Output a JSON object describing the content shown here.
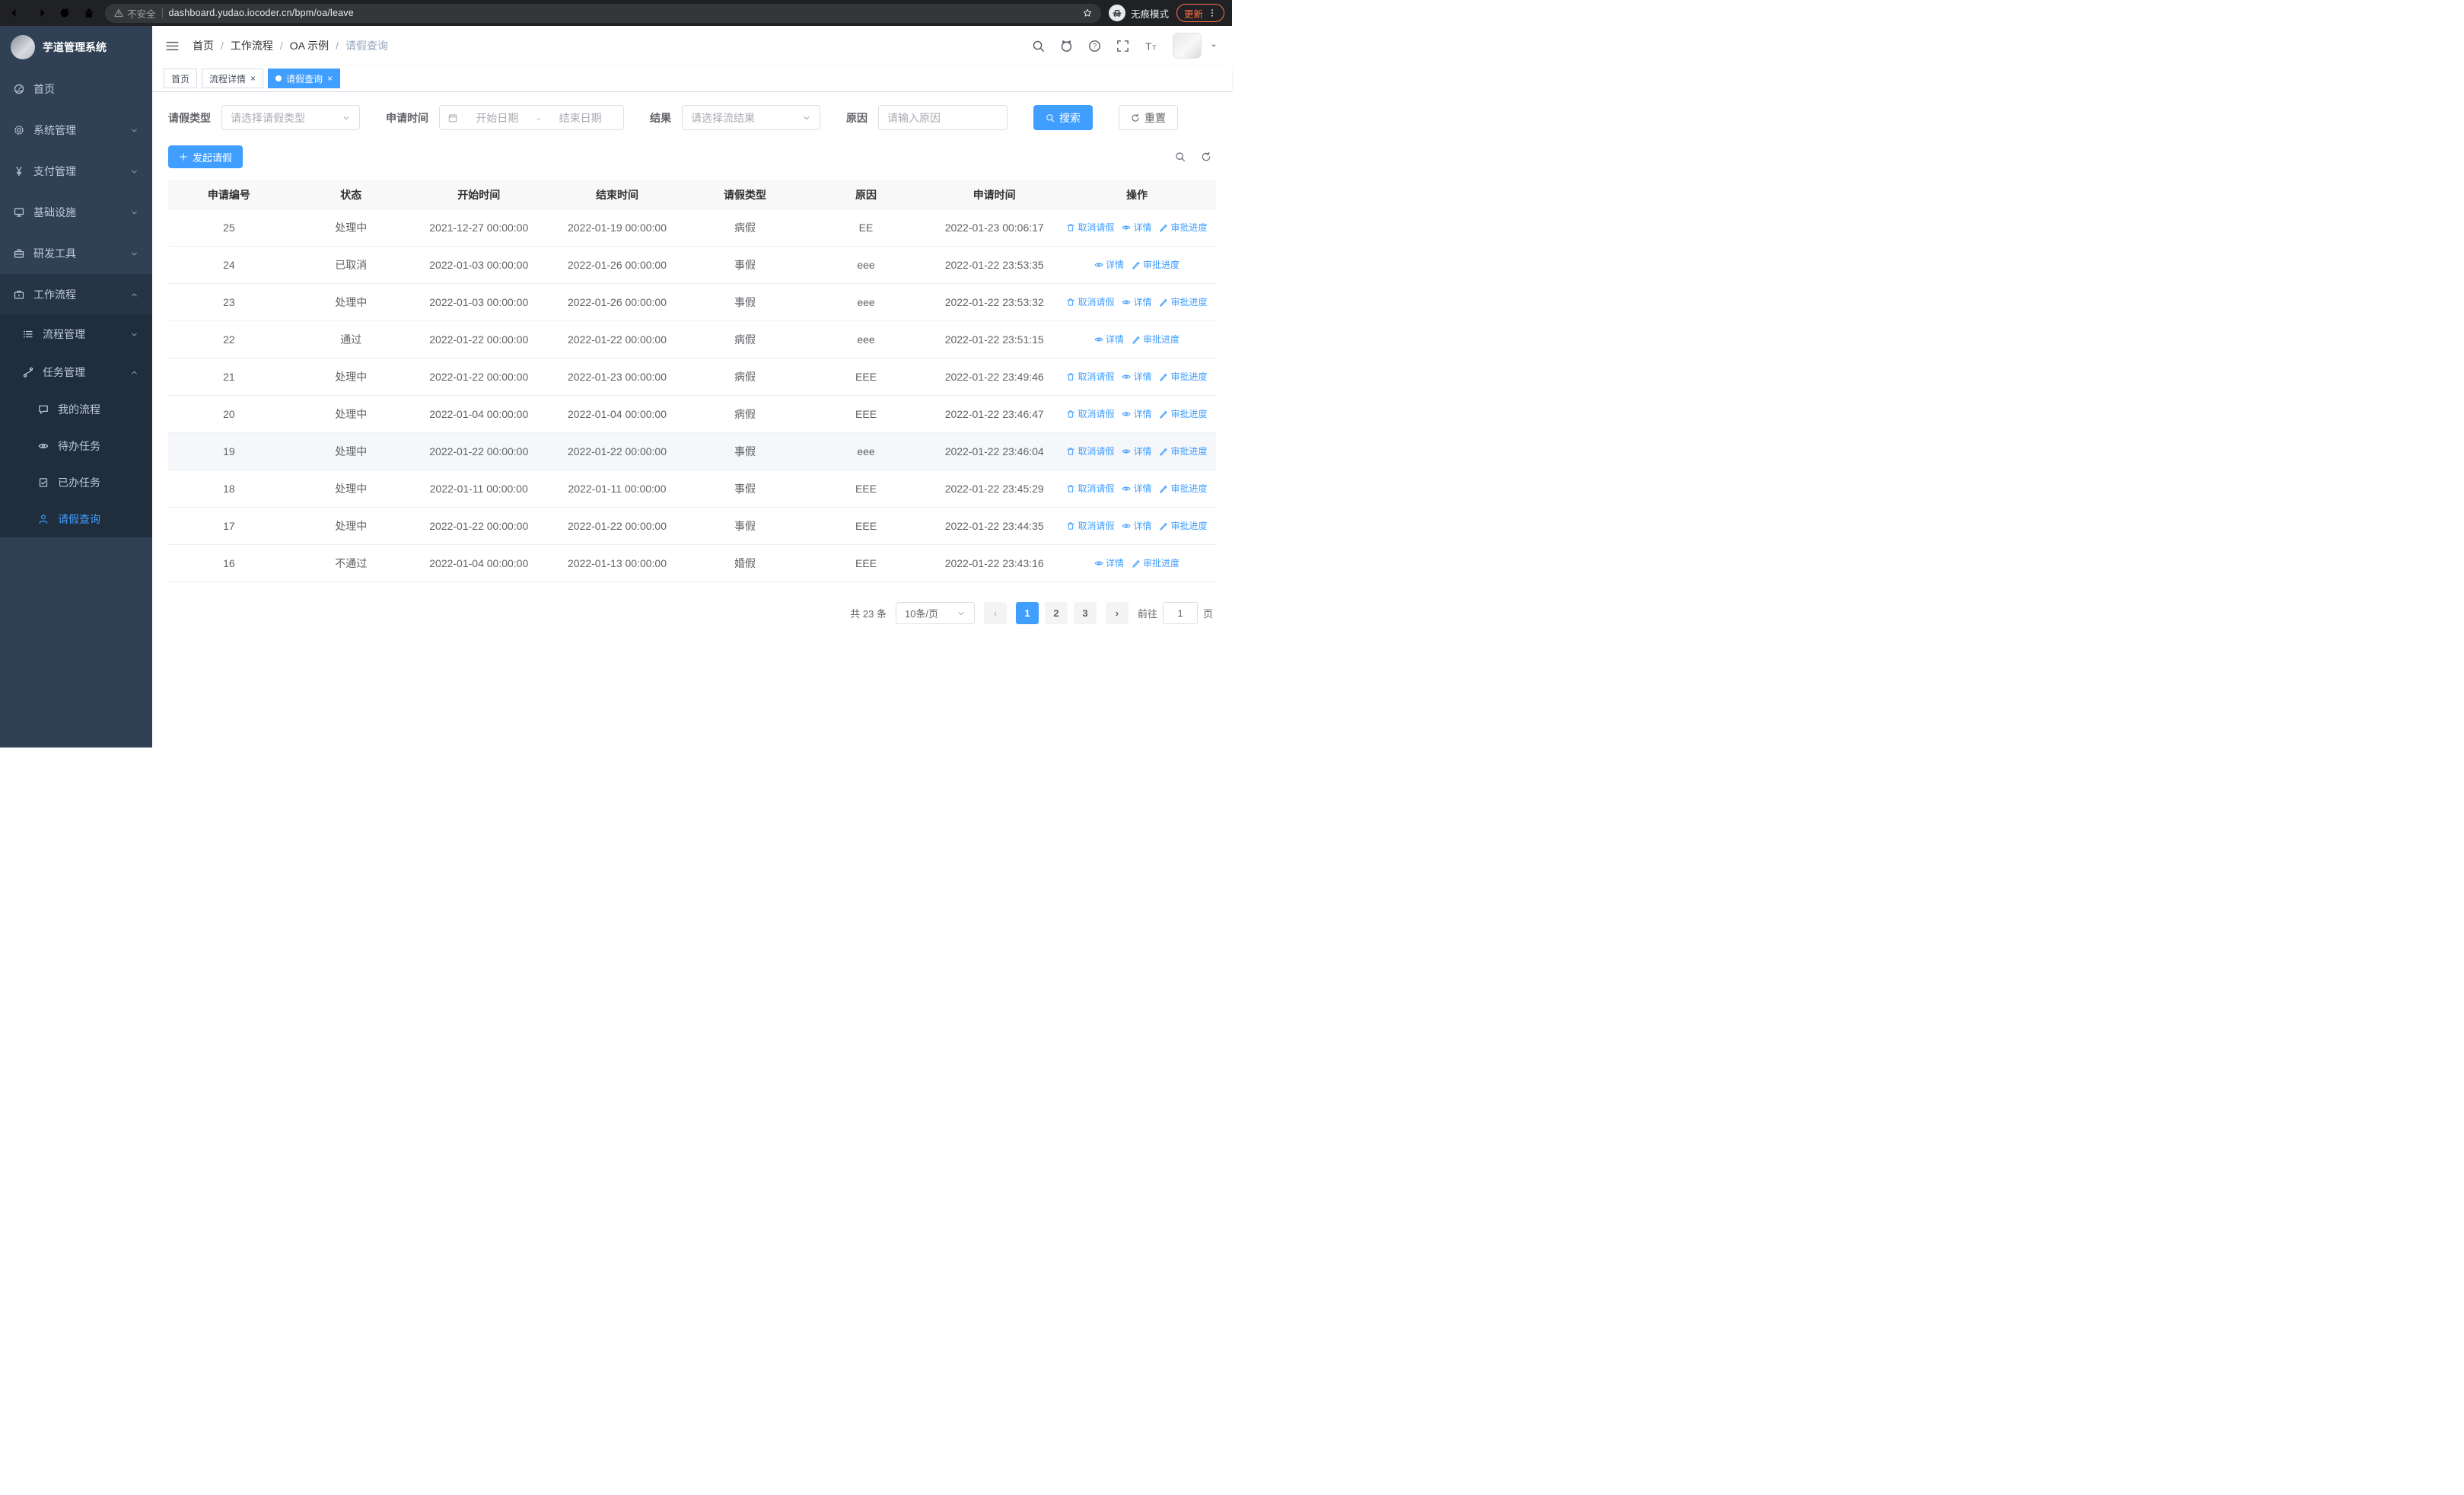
{
  "browser": {
    "security_label": "不安全",
    "url": "dashboard.yudao.iocoder.cn/bpm/oa/leave",
    "incognito_label": "无痕模式",
    "update_label": "更新"
  },
  "app_title": "芋道管理系统",
  "sidebar": {
    "items": [
      {
        "label": "首页",
        "icon": "dashboard-icon",
        "level": 1
      },
      {
        "label": "系统管理",
        "icon": "gear-icon",
        "level": 1,
        "chevron": "down"
      },
      {
        "label": "支付管理",
        "icon": "yen-icon",
        "level": 1,
        "chevron": "down"
      },
      {
        "label": "基础设施",
        "icon": "monitor-icon",
        "level": 1,
        "chevron": "down"
      },
      {
        "label": "研发工具",
        "icon": "toolbox-icon",
        "level": 1,
        "chevron": "down"
      },
      {
        "label": "工作流程",
        "icon": "briefcase-icon",
        "level": 1,
        "chevron": "up",
        "open": true
      },
      {
        "label": "流程管理",
        "icon": "list-icon",
        "level": 2,
        "chevron": "down"
      },
      {
        "label": "任务管理",
        "icon": "flow-icon",
        "level": 2,
        "chevron": "up",
        "open": true
      },
      {
        "label": "我的流程",
        "icon": "chat-icon",
        "level": 3
      },
      {
        "label": "待办任务",
        "icon": "eye-icon",
        "level": 3
      },
      {
        "label": "已办任务",
        "icon": "done-icon",
        "level": 3
      },
      {
        "label": "请假查询",
        "icon": "user-icon",
        "level": 3,
        "active": true
      }
    ]
  },
  "breadcrumb": [
    "首页",
    "工作流程",
    "OA 示例",
    "请假查询"
  ],
  "breadcrumb_separator": "/",
  "tabs": [
    {
      "label": "首页",
      "closable": false,
      "active": false
    },
    {
      "label": "流程详情",
      "closable": true,
      "active": false
    },
    {
      "label": "请假查询",
      "closable": true,
      "active": true
    }
  ],
  "ui": {
    "close_glyph": "×"
  },
  "filters": {
    "leave_type_label": "请假类型",
    "leave_type_placeholder": "请选择请假类型",
    "apply_time_label": "申请时间",
    "start_date_placeholder": "开始日期",
    "range_separator": "-",
    "end_date_placeholder": "结束日期",
    "result_label": "结果",
    "result_placeholder": "请选择流结果",
    "reason_label": "原因",
    "reason_placeholder": "请输入原因",
    "search_button": "搜索",
    "reset_button": "重置"
  },
  "toolbar": {
    "create_button": "发起请假"
  },
  "table": {
    "columns": [
      "申请编号",
      "状态",
      "开始时间",
      "结束时间",
      "请假类型",
      "原因",
      "申请时间",
      "操作"
    ],
    "action_labels": {
      "cancel": "取消请假",
      "detail": "详情",
      "progress": "审批进度"
    },
    "action_icons": {
      "cancel": "trash-icon",
      "detail": "eye-icon",
      "progress": "edit-icon"
    },
    "rows": [
      {
        "id": "25",
        "status": "处理中",
        "start": "2021-12-27 00:00:00",
        "end": "2022-01-19 00:00:00",
        "type": "病假",
        "reason": "EE",
        "applied": "2022-01-23 00:06:17",
        "actions": [
          "cancel",
          "detail",
          "progress"
        ]
      },
      {
        "id": "24",
        "status": "已取消",
        "start": "2022-01-03 00:00:00",
        "end": "2022-01-26 00:00:00",
        "type": "事假",
        "reason": "eee",
        "applied": "2022-01-22 23:53:35",
        "actions": [
          "detail",
          "progress"
        ]
      },
      {
        "id": "23",
        "status": "处理中",
        "start": "2022-01-03 00:00:00",
        "end": "2022-01-26 00:00:00",
        "type": "事假",
        "reason": "eee",
        "applied": "2022-01-22 23:53:32",
        "actions": [
          "cancel",
          "detail",
          "progress"
        ]
      },
      {
        "id": "22",
        "status": "通过",
        "start": "2022-01-22 00:00:00",
        "end": "2022-01-22 00:00:00",
        "type": "病假",
        "reason": "eee",
        "applied": "2022-01-22 23:51:15",
        "actions": [
          "detail",
          "progress"
        ]
      },
      {
        "id": "21",
        "status": "处理中",
        "start": "2022-01-22 00:00:00",
        "end": "2022-01-23 00:00:00",
        "type": "病假",
        "reason": "EEE",
        "applied": "2022-01-22 23:49:46",
        "actions": [
          "cancel",
          "detail",
          "progress"
        ]
      },
      {
        "id": "20",
        "status": "处理中",
        "start": "2022-01-04 00:00:00",
        "end": "2022-01-04 00:00:00",
        "type": "病假",
        "reason": "EEE",
        "applied": "2022-01-22 23:46:47",
        "actions": [
          "cancel",
          "detail",
          "progress"
        ]
      },
      {
        "id": "19",
        "status": "处理中",
        "start": "2022-01-22 00:00:00",
        "end": "2022-01-22 00:00:00",
        "type": "事假",
        "reason": "eee",
        "applied": "2022-01-22 23:46:04",
        "actions": [
          "cancel",
          "detail",
          "progress"
        ],
        "highlight": true
      },
      {
        "id": "18",
        "status": "处理中",
        "start": "2022-01-11 00:00:00",
        "end": "2022-01-11 00:00:00",
        "type": "事假",
        "reason": "EEE",
        "applied": "2022-01-22 23:45:29",
        "actions": [
          "cancel",
          "detail",
          "progress"
        ]
      },
      {
        "id": "17",
        "status": "处理中",
        "start": "2022-01-22 00:00:00",
        "end": "2022-01-22 00:00:00",
        "type": "事假",
        "reason": "EEE",
        "applied": "2022-01-22 23:44:35",
        "actions": [
          "cancel",
          "detail",
          "progress"
        ]
      },
      {
        "id": "16",
        "status": "不通过",
        "start": "2022-01-04 00:00:00",
        "end": "2022-01-13 00:00:00",
        "type": "婚假",
        "reason": "EEE",
        "applied": "2022-01-22 23:43:16",
        "actions": [
          "detail",
          "progress"
        ]
      }
    ]
  },
  "pagination": {
    "total_text": "共 23 条",
    "page_size_text": "10条/页",
    "prev_glyph": "‹",
    "next_glyph": "›",
    "pages": [
      "1",
      "2",
      "3"
    ],
    "active_page": "1",
    "goto_label": "前往",
    "goto_value": "1",
    "goto_suffix": "页"
  },
  "colors": {
    "primary": "#409eff",
    "sidebar_bg": "#304156",
    "sidebar_sub_bg": "#1f2d3d"
  }
}
